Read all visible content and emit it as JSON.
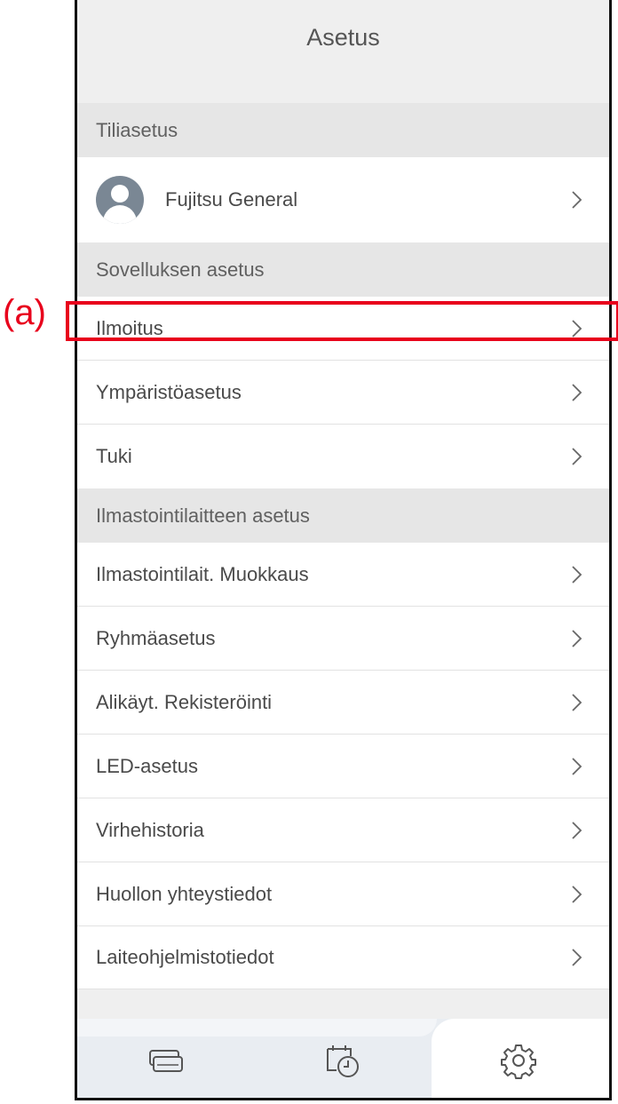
{
  "annotation": {
    "label": "(a)"
  },
  "header": {
    "title": "Asetus"
  },
  "sections": {
    "account": {
      "title": "Tiliasetus"
    },
    "app": {
      "title": "Sovelluksen asetus"
    },
    "ac": {
      "title": "Ilmastointilaitteen asetus"
    }
  },
  "account": {
    "name": "Fujitsu General"
  },
  "app_items": [
    "Ilmoitus",
    "Ympäristöasetus",
    "Tuki"
  ],
  "ac_items": [
    "Ilmastointilait. Muokkaus",
    "Ryhmäasetus",
    "Alikäyt. Rekisteröinti",
    "LED-asetus",
    "Virhehistoria",
    "Huollon yhteystiedot",
    "Laiteohjelmistotiedot"
  ],
  "tabs": {
    "icons": [
      "devices-icon",
      "timer-icon",
      "gear-icon"
    ]
  },
  "colors": {
    "highlight": "#e8001c",
    "section_bg": "#e6e6e6",
    "tab_bg": "#e9edf2"
  }
}
